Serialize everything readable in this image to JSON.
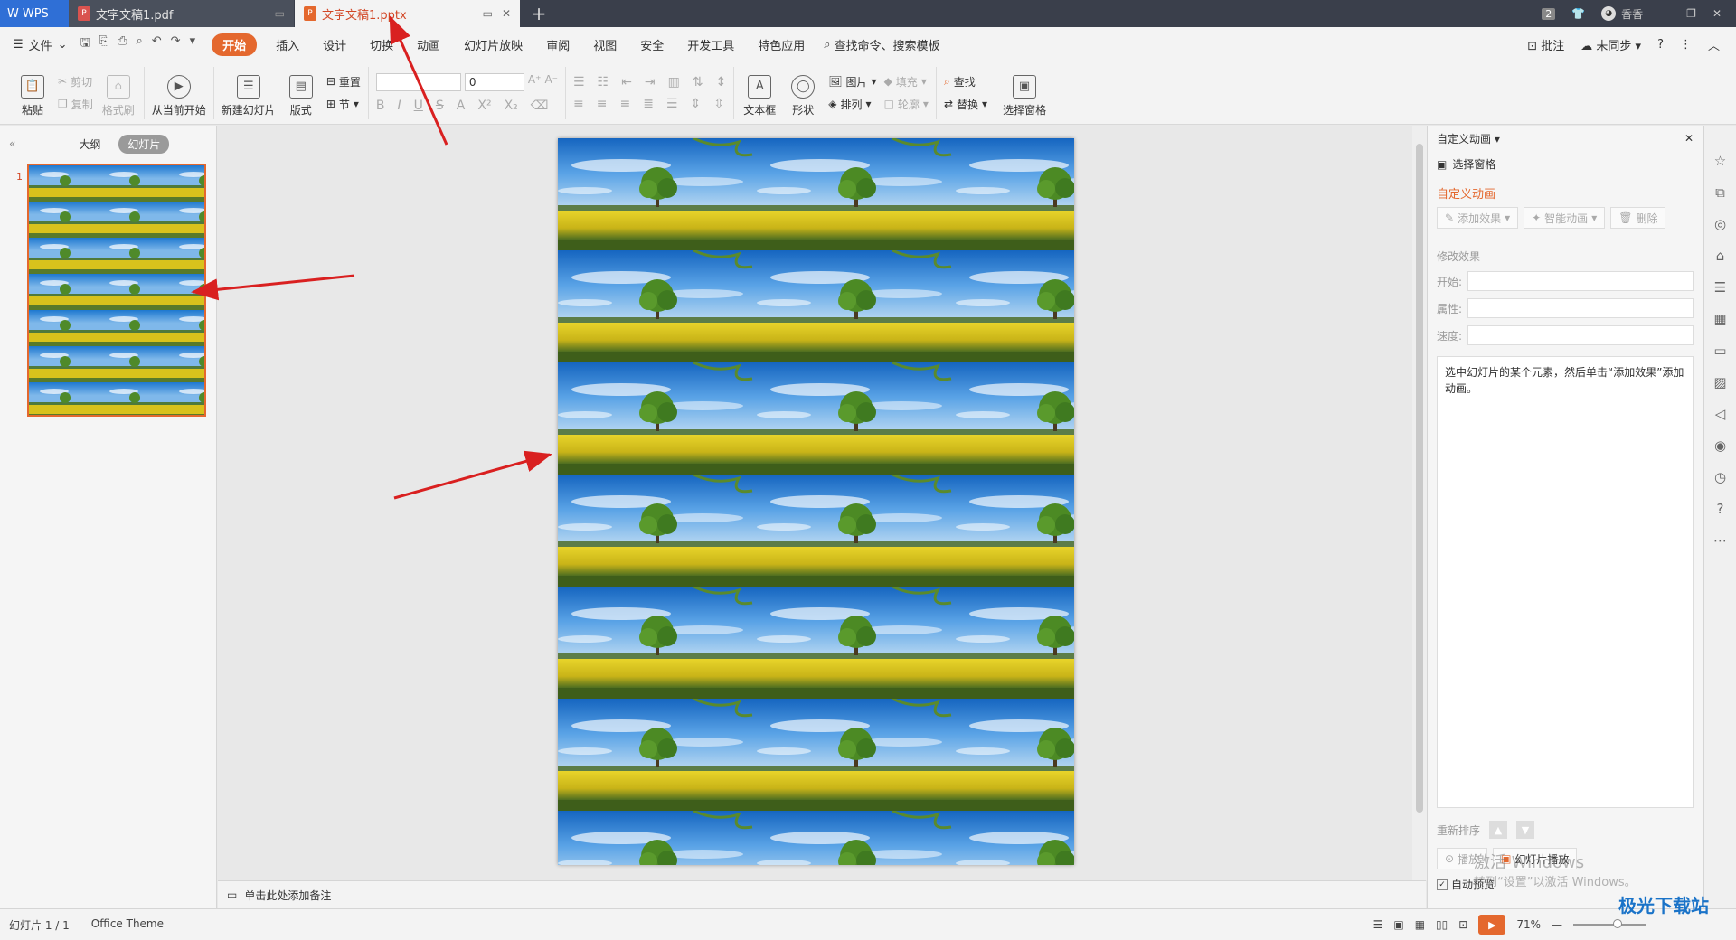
{
  "titlebar": {
    "app": "WPS",
    "tabs": [
      {
        "label": "文字文稿1.pdf",
        "icon": "pdf-icon",
        "icon_color": "#d9534f"
      },
      {
        "label": "文字文稿1.pptx",
        "icon": "ppt-icon",
        "icon_color": "#e4682e"
      }
    ],
    "page_badge": "2",
    "user": "香香"
  },
  "menubar": {
    "file_label": "文件",
    "tabs": [
      "开始",
      "插入",
      "设计",
      "切换",
      "动画",
      "幻灯片放映",
      "审阅",
      "视图",
      "安全",
      "开发工具",
      "特色应用"
    ],
    "search_label": "查找命令、搜索模板",
    "comment_label": "批注",
    "sync_label": "未同步"
  },
  "ribbon": {
    "paste": "粘贴",
    "cut": "剪切",
    "copy": "复制",
    "format_painter": "格式刷",
    "play_from_current": "从当前开始",
    "new_slide": "新建幻灯片",
    "layout": "版式",
    "reset": "重置",
    "section": "节",
    "font_size_value": "0",
    "textbox": "文本框",
    "shape": "形状",
    "picture": "图片",
    "fill": "填充",
    "arrange": "排列",
    "outline": "轮廓",
    "find": "查找",
    "replace": "替换",
    "selection_pane": "选择窗格"
  },
  "leftpane": {
    "outline_tab": "大纲",
    "slides_tab": "幻灯片",
    "slide_number": "1"
  },
  "notes": {
    "placeholder": "单击此处添加备注"
  },
  "rightpanel": {
    "title": "自定义动画",
    "selection_pane": "选择窗格",
    "section_title": "自定义动画",
    "add_effect": "添加效果",
    "smart_anim": "智能动画",
    "delete": "删除",
    "modify_label": "修改效果",
    "start_label": "开始:",
    "property_label": "属性:",
    "speed_label": "速度:",
    "hint": "选中幻灯片的某个元素，然后单击“添加效果”添加动画。",
    "reorder_label": "重新排序",
    "play_btn": "播放",
    "slideshow_btn": "幻灯片播放",
    "autopreview": "自动预览"
  },
  "statusbar": {
    "slide_info": "幻灯片 1 / 1",
    "theme": "Office Theme",
    "zoom": "71%"
  },
  "watermark": {
    "line1": "激活 Windows",
    "line2": "转到“设置”以激活 Windows。"
  },
  "site_logo": "极光下载站",
  "colors": {
    "accent": "#e4682e",
    "annotation": "#d92020"
  }
}
